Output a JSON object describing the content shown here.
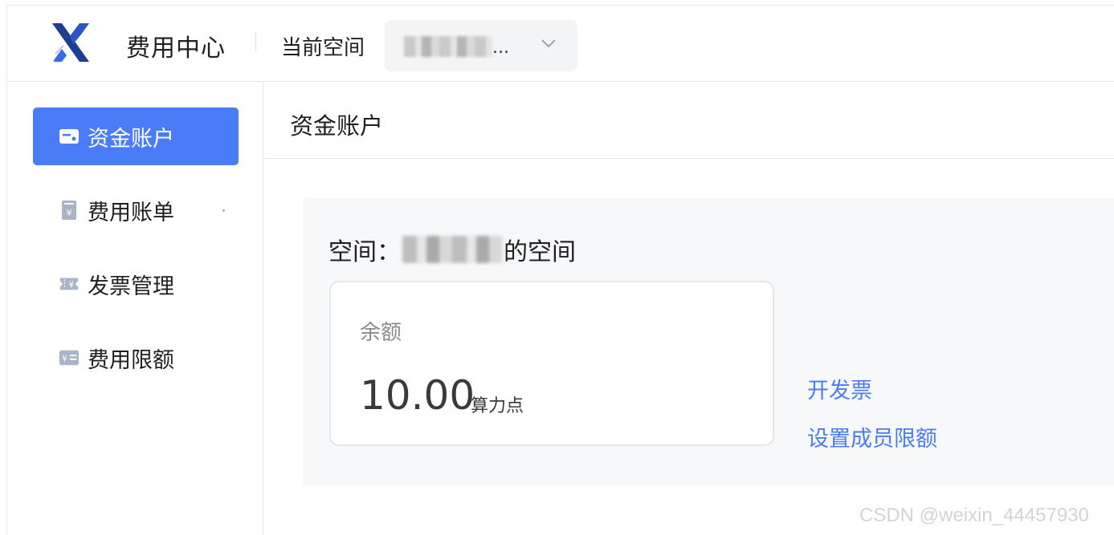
{
  "header": {
    "app_title": "费用中心",
    "space_label": "当前空间",
    "space_select": {
      "value_suffix": "..."
    }
  },
  "sidebar": {
    "items": [
      {
        "label": "资金账户",
        "icon": "wallet-card-icon",
        "active": true
      },
      {
        "label": "费用账单",
        "icon": "receipt-yen-icon",
        "active": false
      },
      {
        "label": "发票管理",
        "icon": "ticket-yen-icon",
        "active": false
      },
      {
        "label": "费用限额",
        "icon": "limit-card-icon",
        "active": false
      }
    ]
  },
  "content": {
    "title": "资金账户",
    "space_prefix": "空间：",
    "space_suffix": "的空间",
    "balance": {
      "label": "余额",
      "value": "10.00",
      "unit": "算力点"
    },
    "links": {
      "invoice": "开发票",
      "member_limit": "设置成员限额"
    }
  },
  "watermark": "CSDN @weixin_44457930",
  "colors": {
    "accent": "#4a7cf7",
    "panel_bg": "#f7f8fa"
  }
}
